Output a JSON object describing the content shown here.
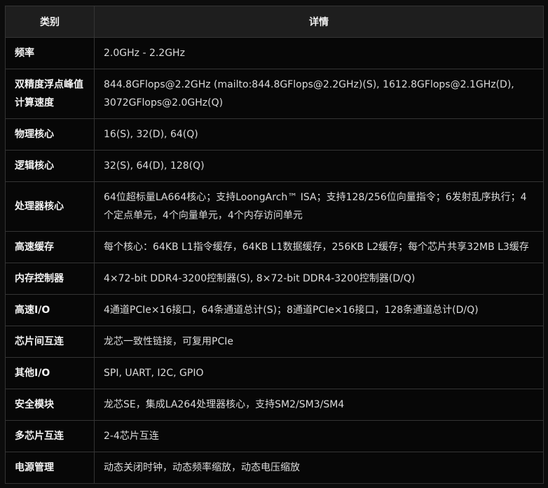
{
  "table": {
    "headers": {
      "category": "类别",
      "details": "详情"
    },
    "rows": [
      {
        "category": "频率",
        "details": "2.0GHz - 2.2GHz"
      },
      {
        "category": "双精度浮点峰值计算速度",
        "details": "844.8GFlops@2.2GHz (mailto:844.8GFlops@2.2GHz)(S), 1612.8GFlops@2.1GHz(D), 3072GFlops@2.0GHz(Q)"
      },
      {
        "category": "物理核心",
        "details": "16(S), 32(D), 64(Q)"
      },
      {
        "category": "逻辑核心",
        "details": "32(S), 64(D), 128(Q)"
      },
      {
        "category": "处理器核心",
        "details": "64位超标量LA664核心；支持LoongArch™ ISA；支持128/256位向量指令；6发射乱序执行；4个定点单元，4个向量单元，4个内存访问单元"
      },
      {
        "category": "高速缓存",
        "details": "每个核心：64KB L1指令缓存，64KB L1数据缓存，256KB L2缓存；每个芯片共享32MB L3缓存"
      },
      {
        "category": "内存控制器",
        "details": "4×72-bit DDR4-3200控制器(S), 8×72-bit DDR4-3200控制器(D/Q)"
      },
      {
        "category": "高速I/O",
        "details": "4通道PCIe×16接口，64条通道总计(S)；8通道PCIe×16接口，128条通道总计(D/Q)"
      },
      {
        "category": "芯片间互连",
        "details": "龙芯一致性链接，可复用PCIe"
      },
      {
        "category": "其他I/O",
        "details": "SPI, UART, I2C, GPIO"
      },
      {
        "category": "安全模块",
        "details": "龙芯SE，集成LA264处理器核心，支持SM2/SM3/SM4"
      },
      {
        "category": "多芯片互连",
        "details": "2-4芯片互连"
      },
      {
        "category": "电源管理",
        "details": "动态关闭时钟，动态频率缩放，动态电压缩放"
      }
    ]
  }
}
